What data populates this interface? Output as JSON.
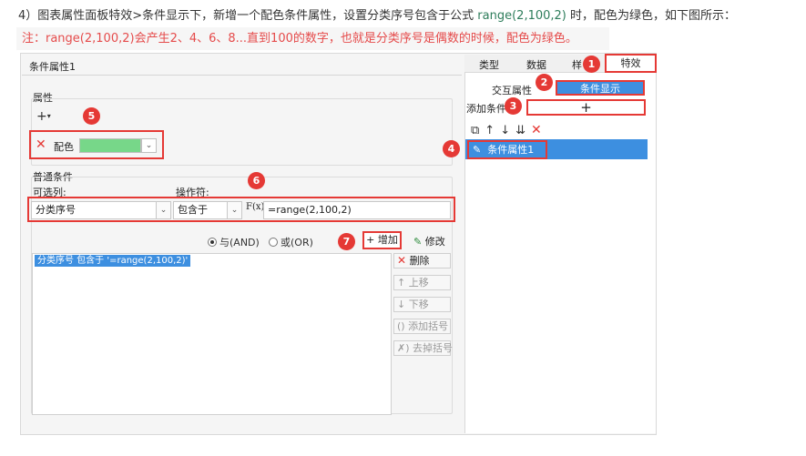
{
  "instruction": {
    "prefix": "4）图表属性面板特效>条件显示下，新增一个配色条件属性，设置分类序号包含于公式 ",
    "code": "range(2,100,2)",
    "suffix": " 时，配色为绿色，如下图所示："
  },
  "note": "注：range(2,100,2)会产生2、4、6、8...直到100的数字，也就是分类序号是偶数的时候，配色为绿色。",
  "dialog": {
    "title": "条件属性1",
    "property_section": "属性",
    "add_property": "+",
    "color_label": "配色",
    "color_value": "#77d789",
    "normal_condition": "普通条件",
    "optional_col_label": "可选列:",
    "operator_label": "操作符:",
    "column_value": "分类序号",
    "operator_value": "包含于",
    "formula_icon": "F(x)",
    "formula_value": "=range(2,100,2)",
    "radio_and": "与(AND)",
    "radio_or": "或(OR)",
    "add_button": "+ 增加",
    "modify_button": "修改",
    "condition_item": "分类序号 包含于 '=range(2,100,2)'",
    "delete_button": "删除",
    "move_up_button": "上移",
    "move_down_button": "下移",
    "add_bracket_button": "添加括号",
    "remove_bracket_button": "去掉括号"
  },
  "right_panel": {
    "tabs": [
      "类型",
      "数据",
      "样",
      "特效"
    ],
    "subtab_interaction": "交互属性",
    "subtab_condition": "条件显示",
    "add_condition_label": "添加条件",
    "add_condition_plus": "+",
    "list_item": "条件属性1"
  },
  "badges": [
    "1",
    "2",
    "3",
    "4",
    "5",
    "6",
    "7"
  ],
  "colors": {
    "accent": "#3d8fe0",
    "annotation_red": "#e53935",
    "green": "#77d789"
  }
}
